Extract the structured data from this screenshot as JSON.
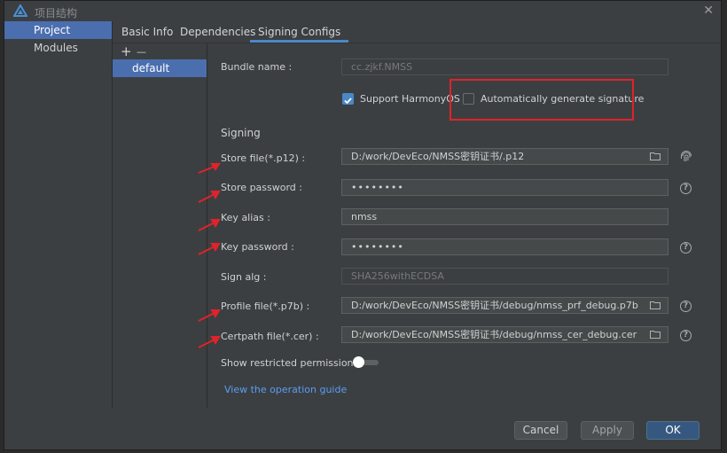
{
  "window": {
    "title": "项目结构",
    "close_label": "✕"
  },
  "left_nav": {
    "items": [
      {
        "label": "Project"
      },
      {
        "label": "Modules"
      }
    ]
  },
  "tabs": [
    {
      "label": "Basic Info"
    },
    {
      "label": "Dependencies"
    },
    {
      "label": "Signing Configs"
    }
  ],
  "config_list": {
    "add": "+",
    "remove": "—",
    "items": [
      {
        "label": "default"
      }
    ]
  },
  "form": {
    "bundle_name": {
      "label": "Bundle name :",
      "value": "cc.zjkf.NMSS"
    },
    "support_harmonyos": {
      "label": "Support HarmonyOS",
      "checked": true
    },
    "auto_signature": {
      "label": "Automatically generate signature",
      "checked": false
    },
    "signing_section": "Signing",
    "store_file": {
      "label": "Store file(*.p12) :",
      "value": "D:/work/DevEco/NMSS密钥证书/.p12"
    },
    "store_password": {
      "label": "Store password :",
      "value": "••••••••"
    },
    "key_alias": {
      "label": "Key alias :",
      "value": "nmss"
    },
    "key_password": {
      "label": "Key password :",
      "value": "••••••••"
    },
    "sign_alg": {
      "label": "Sign alg :",
      "value": "SHA256withECDSA"
    },
    "profile_file": {
      "label": "Profile file(*.p7b) :",
      "value": "D:/work/DevEco/NMSS密钥证书/debug/nmss_prf_debug.p7b"
    },
    "certpath_file": {
      "label": "Certpath file(*.cer) :",
      "value": "D:/work/DevEco/NMSS密钥证书/debug/nmss_cer_debug.cer"
    },
    "restricted_permissions": {
      "label": "Show restricted permissions",
      "on": false
    },
    "guide_link": "View the operation guide",
    "help_glyph": "?"
  },
  "buttons": {
    "cancel": "Cancel",
    "apply": "Apply",
    "ok": "OK"
  },
  "colors": {
    "accent": "#4b6eaf",
    "annotation_red": "#e0232a",
    "link": "#589df6"
  }
}
